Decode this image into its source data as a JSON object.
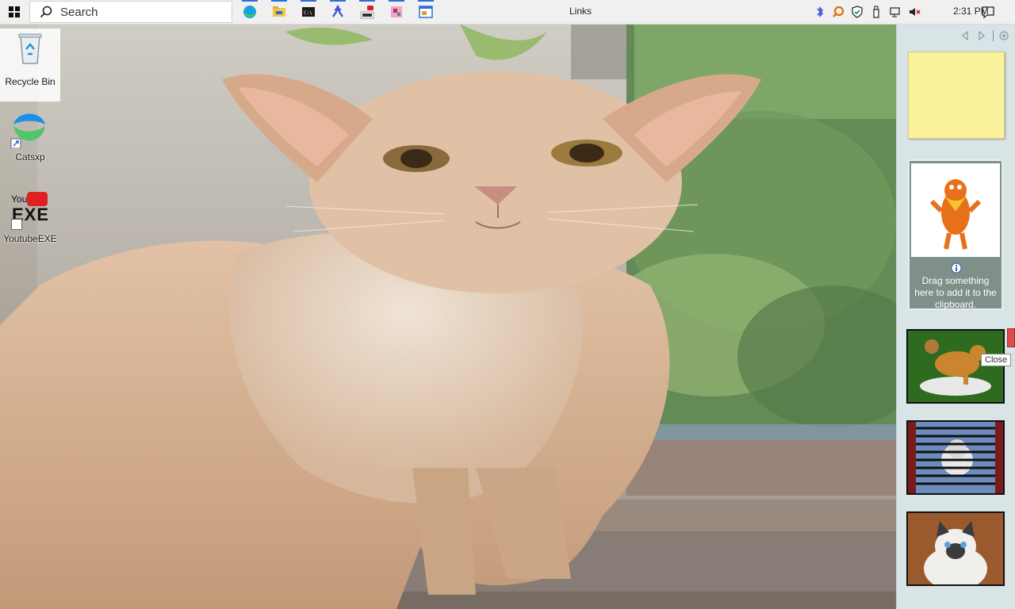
{
  "taskbar": {
    "search_placeholder": "Search",
    "toolbar_label": "Links",
    "clock": "2:31 PM",
    "accent": "#2b6fd6"
  },
  "desktop": {
    "icons": [
      {
        "label": "Recycle Bin",
        "icon": "recycle-bin-icon"
      },
      {
        "label": "Catsxp",
        "icon": "catsxp-icon"
      },
      {
        "label": "YoutubeEXE",
        "icon": "youtube-exe-icon",
        "badge": "EXE"
      }
    ]
  },
  "sidebar": {
    "clipboard_hint": "Drag something here to add it to the clipboard.",
    "close_tooltip": "Close"
  }
}
